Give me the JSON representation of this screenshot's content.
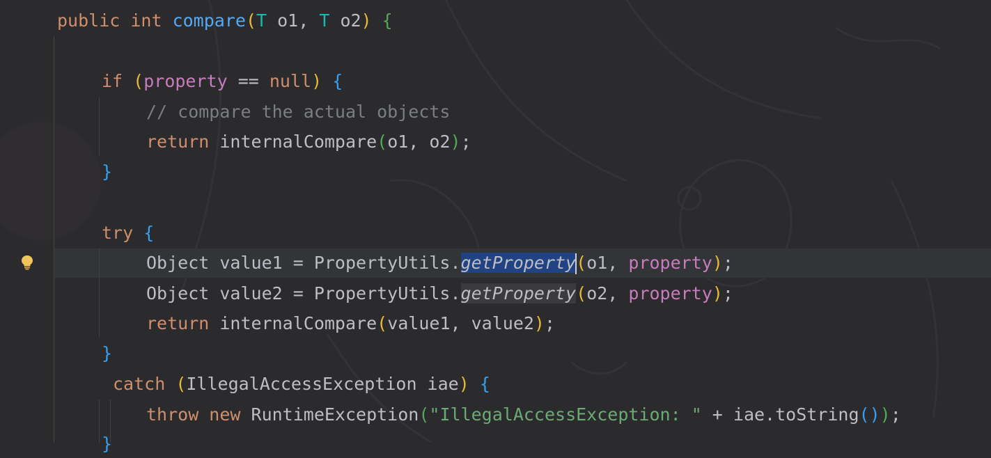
{
  "colors": {
    "background": "#2b2b2d",
    "keyword": "#cf8e6d",
    "function": "#56a8f5",
    "type_param": "#16baac",
    "field": "#c77dbb",
    "comment": "#7a7e85",
    "string": "#6aab73",
    "selection": "#214283",
    "caret_line": "#323438"
  },
  "gutter": {
    "intention_icon": "lightbulb-icon"
  },
  "code": {
    "l1": {
      "kw": "public int ",
      "name": "compare",
      "lp": "(",
      "t1": "T",
      "a1": " o1, ",
      "t2": "T",
      "a2": " o2",
      "rp": ")",
      "brace": " {"
    },
    "l2": {
      "kw": "if ",
      "lp": "(",
      "field": "property",
      "op": " == ",
      "kw2": "null",
      "rp": ")",
      "brace": " {"
    },
    "l3": {
      "comment": "// compare the actual objects"
    },
    "l4": {
      "kw": "return ",
      "call": "internalCompare",
      "lp": "(",
      "args": "o1, o2",
      "rp": ")",
      "semi": ";"
    },
    "l5": {
      "brace": "}"
    },
    "l6": {
      "kw": "try ",
      "brace": "{"
    },
    "l7": {
      "pre": "Object value1 = PropertyUtils.",
      "method": "getProperty",
      "lp": "(",
      "arg": "o1, ",
      "field": "property",
      "rp": ")",
      "semi": ";"
    },
    "l8": {
      "pre": "Object value2 = PropertyUtils.",
      "method": "getProperty",
      "lp": "(",
      "arg": "o2, ",
      "field": "property",
      "rp": ")",
      "semi": ";"
    },
    "l9": {
      "kw": "return ",
      "call": "internalCompare",
      "lp": "(",
      "args": "value1, value2",
      "rp": ")",
      "semi": ";"
    },
    "l10": {
      "brace": "}"
    },
    "l11": {
      "kw": "catch ",
      "lp": "(",
      "args": "IllegalAccessException iae",
      "rp": ")",
      "brace": " {"
    },
    "l12": {
      "kw": "throw new ",
      "cls": "RuntimeException",
      "lp": "(",
      "str": "\"IllegalAccessException: \"",
      "op": " + iae.toString",
      "ilp": "(",
      "irp": ")",
      "rp": ")",
      "semi": ";"
    },
    "l13": {
      "brace": "}"
    }
  }
}
